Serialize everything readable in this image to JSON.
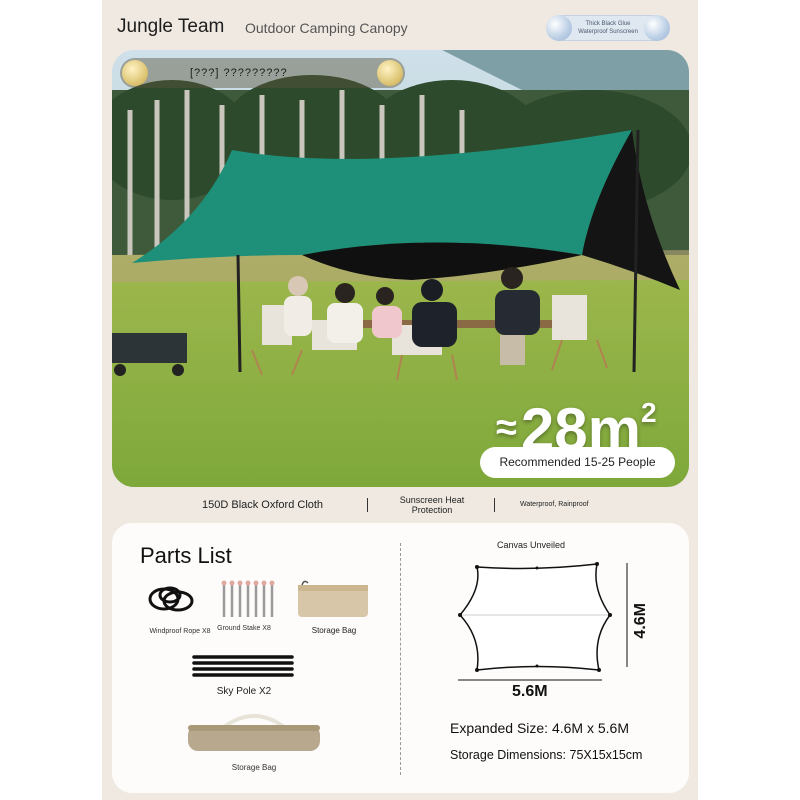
{
  "header": {
    "brand": "Jungle Team",
    "subtitle": "Outdoor Camping Canopy",
    "badge_text": "Thick Black Glue Waterproof Sunscreen"
  },
  "photo": {
    "banner_text": "[???] ?????????",
    "area_approx": "≈",
    "area_value": "28m",
    "area_sup": "2",
    "recommend": "Recommended 15-25 People"
  },
  "features": {
    "item1": "150D Black Oxford Cloth",
    "item2": "Sunscreen Heat Protection",
    "item3": "Waterproof, Rainproof"
  },
  "parts": {
    "title": "Parts List",
    "rope": "Windproof Rope X8",
    "stake": "Ground Stake X8",
    "bag_small": "Storage Bag",
    "pole": "Sky Pole X2",
    "bag_large": "Storage Bag",
    "canvas_title": "Canvas Unveiled",
    "width": "5.6M",
    "height": "4.6M",
    "expanded": "Expanded Size: 4.6M x 5.6M",
    "storage": "Storage Dimensions: 75X15x15cm"
  },
  "colors": {
    "canopy": "#1e8f78",
    "page_bg": "#efe9e1"
  }
}
